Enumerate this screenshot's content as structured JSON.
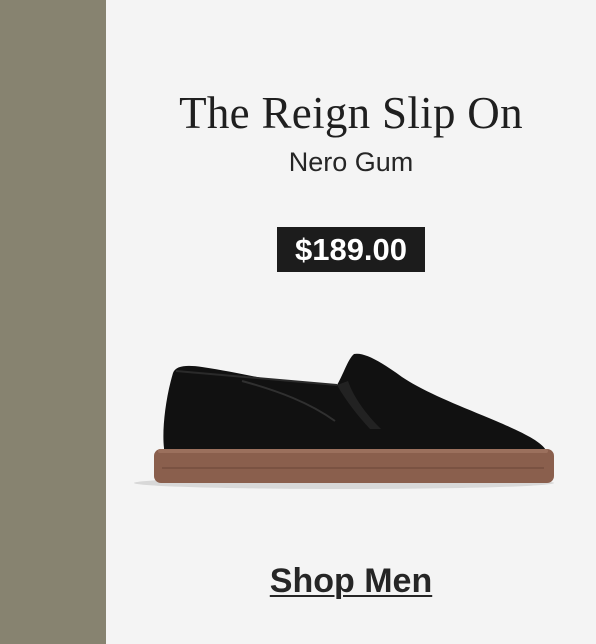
{
  "product": {
    "name": "The Reign Slip On",
    "colorway": "Nero Gum",
    "price": "$189.00"
  },
  "cta": {
    "label": "Shop Men"
  },
  "colors": {
    "side_band": "#878370",
    "background": "#f4f4f4",
    "price_badge": "#1c1c1c",
    "shoe_upper": "#111111",
    "gum_sole": "#8a5f4d"
  },
  "images": {
    "product_image": "black-suede-slip-on-shoe-with-gum-sole"
  }
}
